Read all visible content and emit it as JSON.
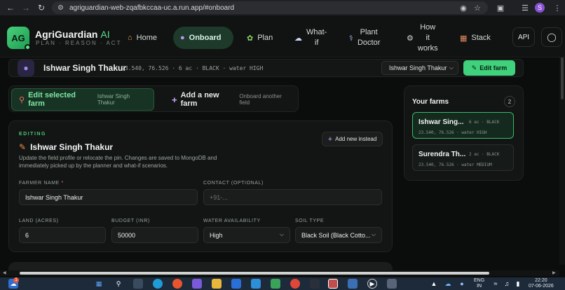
{
  "browser": {
    "url": "agriguardian-web-zqafbkccaa-uc.a.run.app/#onboard",
    "profile_initial": "S"
  },
  "header": {
    "logo_text": "AG",
    "brand_name": "AgriGuardian",
    "brand_suffix": "AI",
    "tagline": "PLAN · REASON · ACT",
    "nav": [
      {
        "label": "Home",
        "icon": "house-icon"
      },
      {
        "label": "Onboard",
        "icon": "person-icon",
        "active": true
      },
      {
        "label": "Plan",
        "icon": "sprout-icon"
      },
      {
        "label_lines": [
          "What-",
          "if"
        ],
        "icon": "cloud-icon"
      },
      {
        "label_lines": [
          "Plant",
          "Doctor"
        ],
        "icon": "stethoscope-icon"
      },
      {
        "label_lines": [
          "How",
          "it",
          "works"
        ],
        "icon": "gear-icon"
      },
      {
        "label": "Stack",
        "icon": "stack-icon"
      }
    ],
    "api_label": "API",
    "github_icon": "github-icon"
  },
  "current_farm": {
    "name": "Ishwar Singh Thakur",
    "meta": "23.540, 76.526 · 6 ac · BLACK · water HIGH",
    "select_value": "Ishwar Singh Thakur",
    "edit_button": "Edit farm"
  },
  "mode": {
    "edit_label": "Edit selected farm",
    "edit_sub": "Ishwar Singh Thakur",
    "add_label": "Add a new farm",
    "add_sub": "Onboard another field"
  },
  "form": {
    "editing_label": "EDITING",
    "title": "Ishwar Singh Thakur",
    "description": "Update the field profile or relocate the pin. Changes are saved to MongoDB and immediately picked up by the planner and what-if scenarios.",
    "add_new_button": "Add new instead",
    "farmer_name_label": "FARMER NAME",
    "farmer_name_required": "*",
    "farmer_name_value": "Ishwar Singh Thakur",
    "contact_label": "CONTACT (OPTIONAL)",
    "contact_placeholder": "+91-...",
    "land_label": "LAND (ACRES)",
    "land_value": "6",
    "budget_label": "BUDGET (INR)",
    "budget_value": "50000",
    "water_label": "WATER AVAILABILITY",
    "water_value": "High",
    "soil_label": "SOIL TYPE",
    "soil_value": "Black Soil (Black Cotto..."
  },
  "your_farms": {
    "title": "Your farms",
    "count": "2",
    "items": [
      {
        "name": "Ishwar Sing...",
        "tag": "6 ac · BLACK",
        "meta": "23.540, 76.526 · water HIGH",
        "selected": true
      },
      {
        "name": "Surendra Th...",
        "tag": "2 ac · BLACK",
        "meta": "23.540, 76.526 · water MEDIUM",
        "selected": false
      }
    ]
  },
  "taskbar": {
    "notification_count": "1",
    "lang_line1": "ENG",
    "lang_line2": "IN",
    "time": "22:20",
    "date": "07-06-2026"
  }
}
